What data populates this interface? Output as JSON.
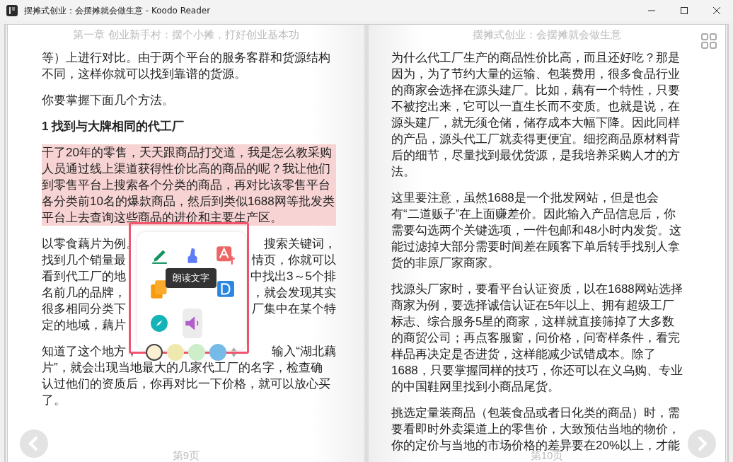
{
  "window": {
    "title": "摆摊式创业：会摆摊就会做生意 - Koodo Reader"
  },
  "left_page": {
    "header": "第一章 创业新手村：摆个小摊，打好创业基本功",
    "page_number": "第9页",
    "blocks": [
      {
        "kind": "paragraph",
        "text": "等）上进行对比。由于两个平台的服务客群和货源结构不同，这样你就可以找到靠谱的货源。"
      },
      {
        "kind": "paragraph",
        "text": "你要掌握下面几个方法。"
      },
      {
        "kind": "heading",
        "text": "1 找到与大牌相同的代工厂"
      },
      {
        "kind": "highlight",
        "text": "干了20年的零售，天天跟商品打交道，我是怎么教采购人员通过线上渠道获得性价比高的商品的呢？我让他们到零售平台上搜索各个分类的商品，再对比该零售平台各分类前10名的爆款商品，然后到类似1688网等批发类平台上去查询这些商品的进价和主要生产区。"
      },
      {
        "kind": "covered",
        "lines": [
          {
            "left": "以零食藕片为例。",
            "right": "搜索关键词，"
          },
          {
            "left": "找到几个销量最",
            "right": "情页，你就可以"
          },
          {
            "left": "看到代工厂的地",
            "right": "中找出3～5个排"
          },
          {
            "left": "名前几的品牌，",
            "right": "，就会发现其实"
          },
          {
            "left": "很多相同分类下",
            "right": "厂集中在某个特"
          },
          {
            "left": "定的地域，藕片"
          }
        ]
      },
      {
        "kind": "covered",
        "lines": [
          {
            "left": "知道了这个地方，",
            "right": "输入“湖北藕"
          },
          {
            "left": "片”，就会出现当地最大的几家代工厂的名字，检查确"
          },
          {
            "left": "认过他们的资质后，你再对比一下价格，就可以放心买"
          },
          {
            "left": "了。"
          }
        ]
      }
    ]
  },
  "right_page": {
    "header": "摆摊式创业：会摆摊就会做生意",
    "page_number": "第10页",
    "blocks": [
      {
        "kind": "paragraph",
        "text": "为什么代工厂生产的商品性价比高，而且还好吃？那是因为，为了节约大量的运输、包装费用，很多食品行业的商家会选择在源头建厂。比如，藕有一个特性，只要不被挖出来，它可以一直生长而不变质。也就是说，在源头建厂，就无须仓储，储存成本大幅下降。因此同样的产品，源头代工厂就卖得更便宜。细挖商品原材料背后的细节，尽量找到最优货源，是我培养采购人才的方法。"
      },
      {
        "kind": "paragraph",
        "text": "这里要注意，虽然1688是一个批发网站，但是也会有“二道贩子”在上面赚差价。因此输入产品信息后，你需要勾选两个关键选项，一件包邮和48小时内发货。这能过滤掉大部分需要时间差在顾客下单后转手找别人拿货的非原厂家商家。"
      },
      {
        "kind": "paragraph",
        "text": "找源头厂家时，要看平台认证资质，以在1688网站选择商家为例，要选择诚信认证在5年以上、拥有超级工厂标志、综合服务5星的商家，这样就直接筛掉了大多数的商贸公司；再点客服窗，问价格，问寄样条件，看完样品再决定是否进货，这样能减少试错成本。除了1688，只要掌握同样的技巧，你还可以在义乌购、专业的中国鞋网里找到小商品尾货。"
      },
      {
        "kind": "paragraph",
        "text": "挑选定量装商品（包装食品或者日化类的商品）时，需要看即时外卖渠道上的零售价，大致预估当地的物价，你的定价与当地的市场价格的差异要在20%以上，才能"
      }
    ]
  },
  "popup": {
    "tooltip": "朗读文字",
    "actions": [
      {
        "kind": "pen",
        "hovered": false
      },
      {
        "kind": "highlighter",
        "hovered": false
      },
      {
        "kind": "translate",
        "hovered": false
      },
      {
        "kind": "copy",
        "hovered": false
      },
      {
        "kind": "dictionary",
        "hovered": false
      },
      {
        "kind": "browse",
        "hovered": false
      },
      {
        "kind": "speak",
        "hovered": true
      }
    ],
    "colors": [
      {
        "color": "#fbf0d2",
        "selected": true
      },
      {
        "color": "#efe9b0",
        "selected": false
      },
      {
        "color": "#cdeec9",
        "selected": false
      },
      {
        "color": "#76bbe8",
        "selected": false
      }
    ]
  }
}
